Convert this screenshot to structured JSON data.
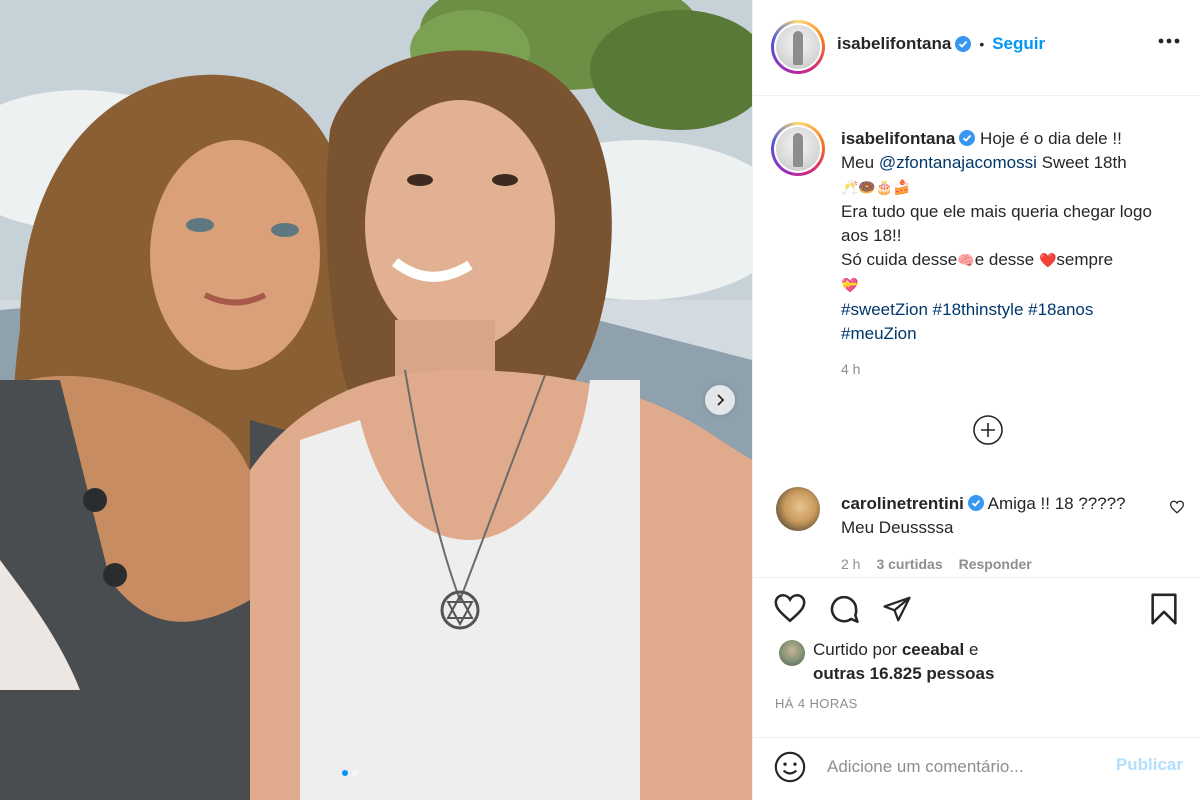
{
  "post": {
    "author": "isabelifontana",
    "follow_label": "Seguir",
    "separator": "•",
    "caption": {
      "line1": "Hoje é o dia dele !!",
      "line2_prefix": "Meu",
      "mention": "@zfontanajacomossi",
      "line2_suffix": "Sweet 18th",
      "emojis": "🥂🍩🎂🍰",
      "line3": "Era tudo que ele mais queria chegar logo aos 18!!",
      "line4_a": "Só cuida desse",
      "emoji_brain": "🧠",
      "line4_b": "e desse",
      "emoji_heart": "❤️",
      "line4_c": "sempre",
      "emoji_gift_heart": "💝",
      "hashtags": [
        "#sweetZion",
        "#18thinstyle",
        "#18anos",
        "#meuZion"
      ]
    },
    "caption_time": "4 h",
    "comment": {
      "author": "carolinetrentini",
      "text": "Amiga !! 18 ????? Meu Deussssa",
      "time": "2 h",
      "likes": "3 curtidas",
      "reply": "Responder"
    },
    "liked_by": {
      "prefix": "Curtido por",
      "user": "ceeabal",
      "conj": "e",
      "others": "outras 16.825 pessoas"
    },
    "posted_ago": "HÁ 4 HORAS",
    "add_comment_placeholder": "Adicione um comentário...",
    "publish_label": "Publicar",
    "carousel": {
      "slides": 2,
      "current": 1
    }
  },
  "icons": [
    "verified-badge-icon",
    "more-options-icon",
    "load-more-plus-icon",
    "heart-icon",
    "comment-icon",
    "share-icon",
    "save-bookmark-icon",
    "smiley-icon",
    "next-arrow-icon"
  ],
  "colors": {
    "link_blue": "#0095f6",
    "text": "#262626",
    "muted": "#8e8e8e",
    "hashtag": "#00376b",
    "publish_disabled": "#b2dffc"
  }
}
